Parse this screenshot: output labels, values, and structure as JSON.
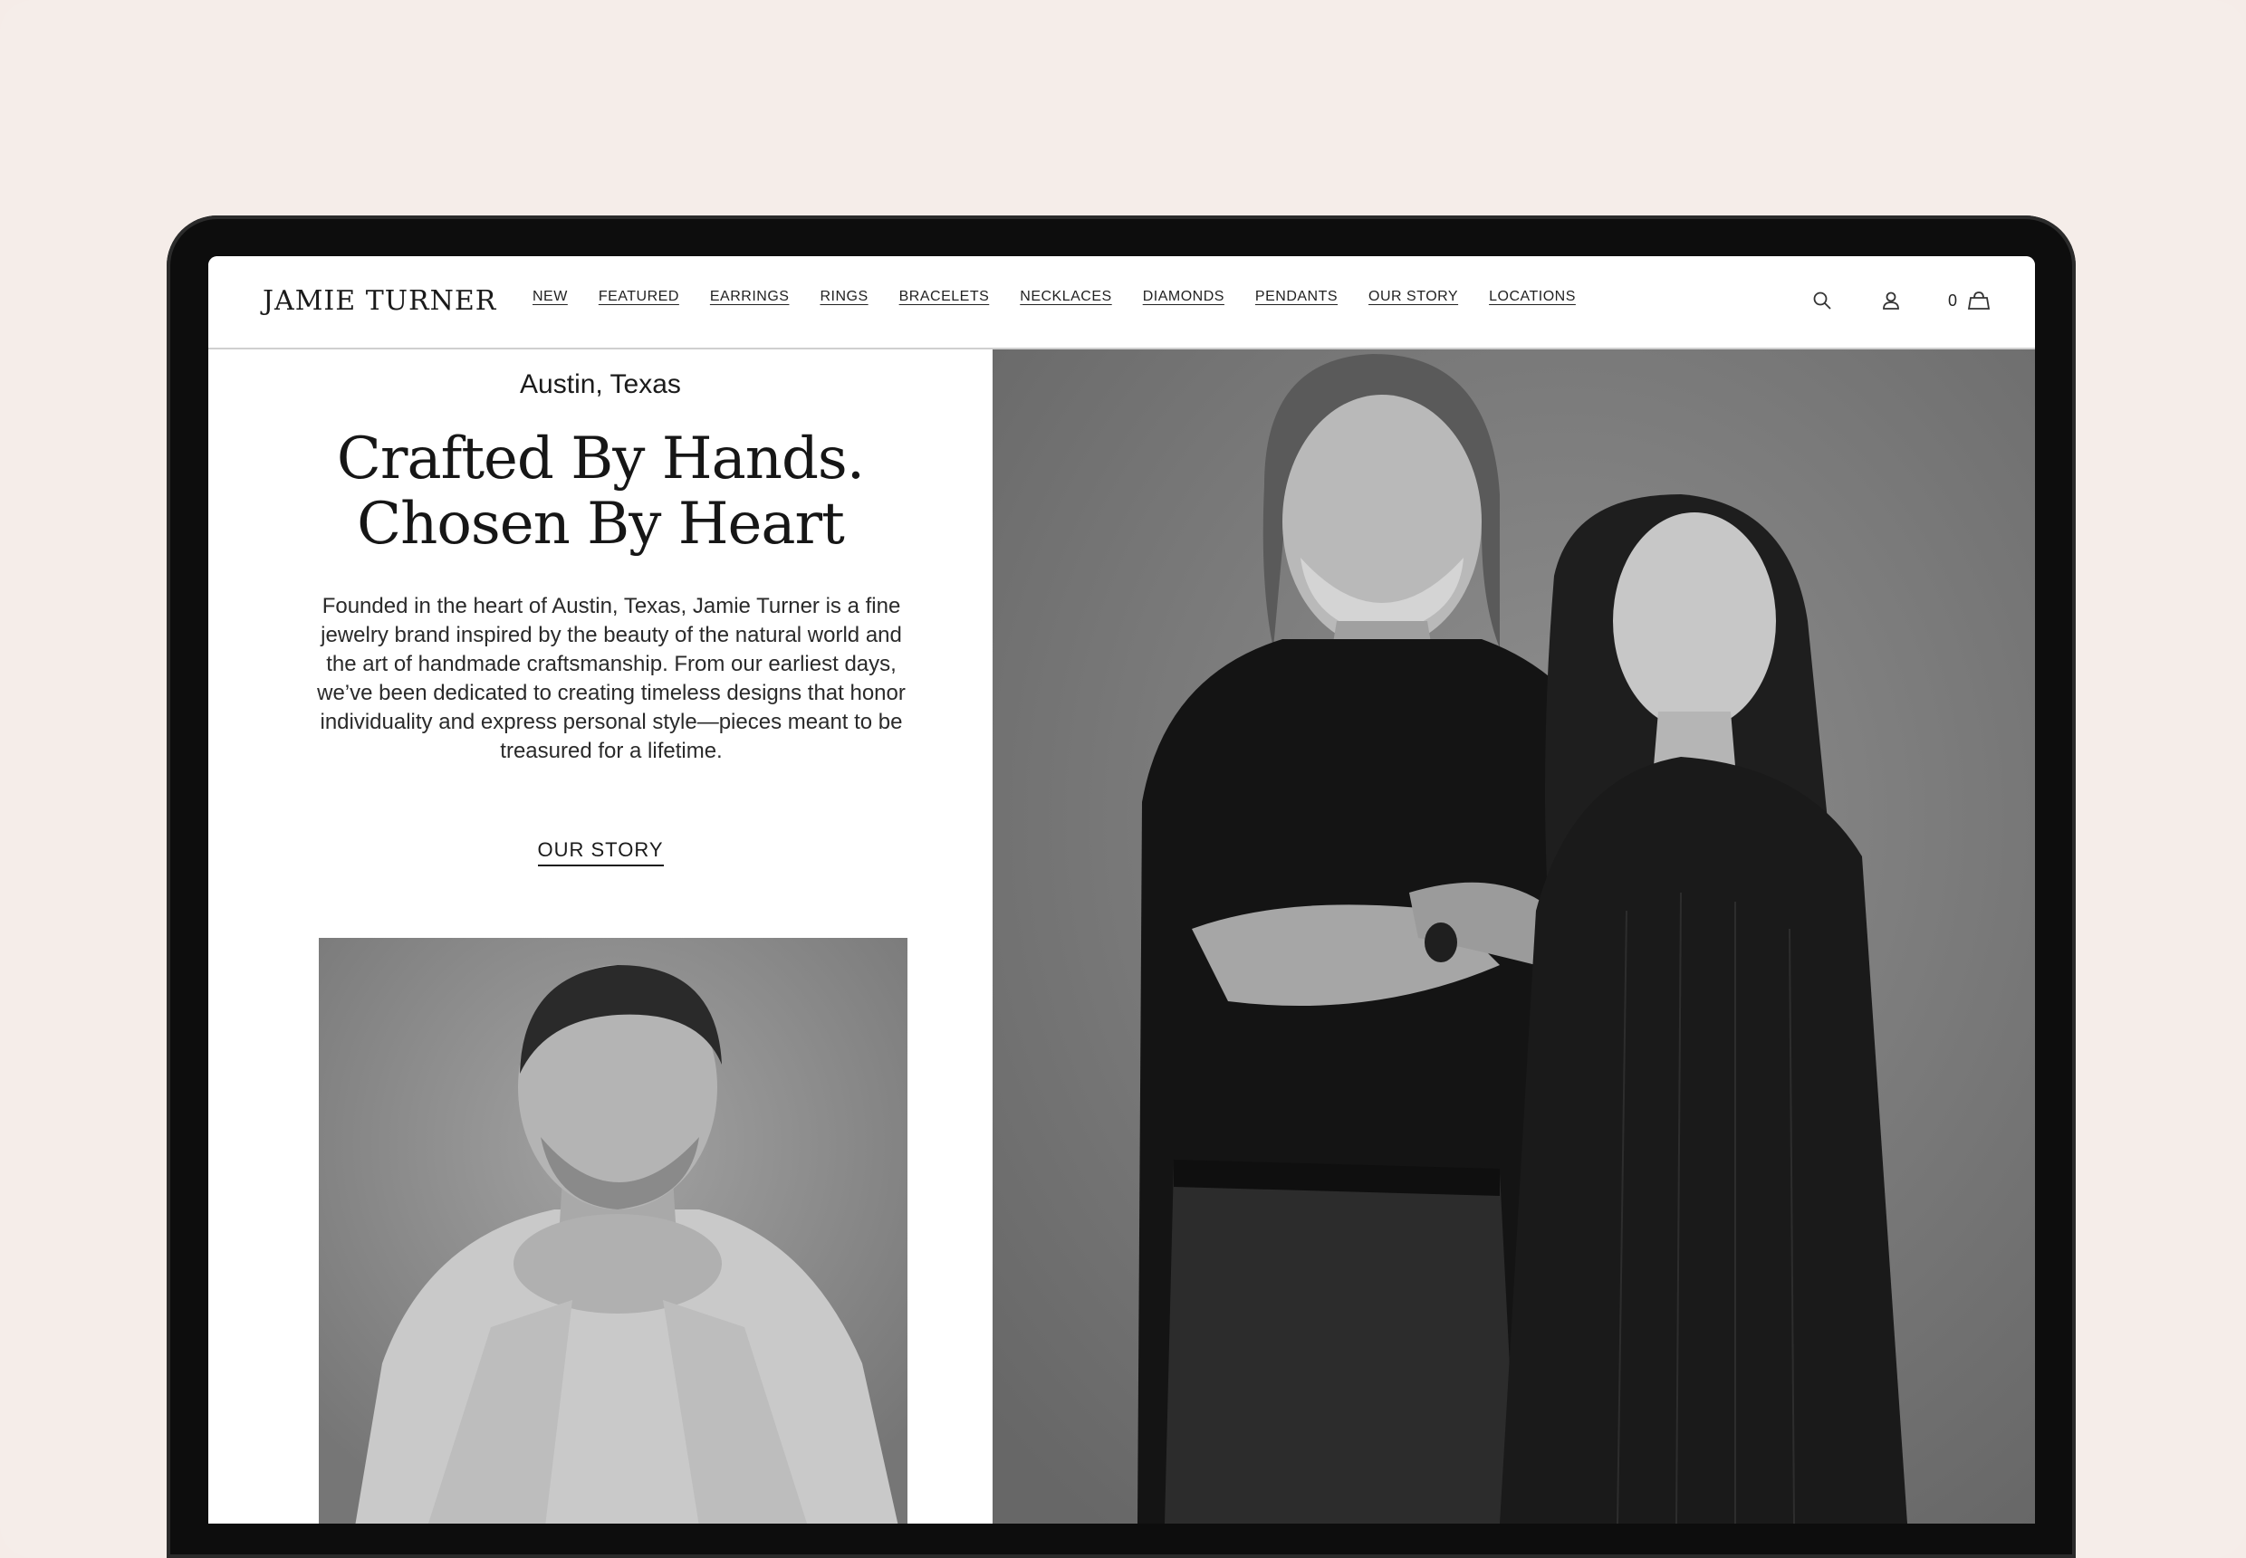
{
  "brand": {
    "logo": "JAMIE TURNER"
  },
  "nav": {
    "items": [
      {
        "label": "NEW"
      },
      {
        "label": "FEATURED"
      },
      {
        "label": "EARRINGS"
      },
      {
        "label": "RINGS"
      },
      {
        "label": "BRACELETS"
      },
      {
        "label": "NECKLACES"
      },
      {
        "label": "DIAMONDS"
      },
      {
        "label": "PENDANTS"
      },
      {
        "label": "OUR STORY"
      },
      {
        "label": "LOCATIONS"
      }
    ]
  },
  "utility": {
    "cart_count": "0"
  },
  "hero": {
    "location": "Austin, Texas",
    "headline_line1": "Crafted By Hands.",
    "headline_line2": "Chosen By Heart",
    "body": "Founded in the heart of Austin, Texas, Jamie Turner is a fine jewelry brand inspired by the beauty of the natural world and the art of handmade craftsmanship. From our earliest days, we’ve been dedicated to creating timeless designs that honor individuality and express personal style—pieces meant to be treasured for a lifetime.",
    "cta": "OUR STORY"
  },
  "colors": {
    "page_background": "#f5ede9",
    "device_frame": "#0d0d0d",
    "text": "#1a1a1a"
  },
  "icons": [
    "search-icon",
    "account-icon",
    "bag-icon"
  ]
}
